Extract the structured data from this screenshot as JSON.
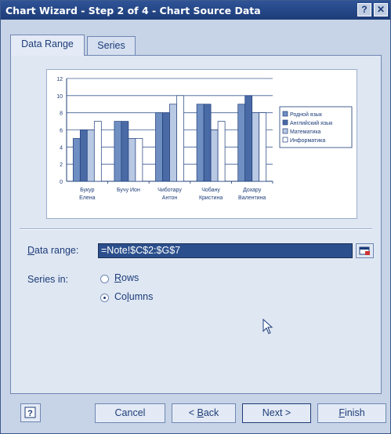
{
  "window": {
    "title": "Chart Wizard - Step 2 of 4 - Chart Source Data",
    "help_glyph": "?",
    "close_glyph": "✕"
  },
  "tabs": [
    {
      "label": "Data Range",
      "active": true
    },
    {
      "label": "Series",
      "active": false
    }
  ],
  "chart_data": {
    "type": "bar",
    "categories": [
      [
        "Букур",
        "Елена"
      ],
      [
        "Бучу Ион",
        ""
      ],
      [
        "Чиботару",
        "Антон"
      ],
      [
        "Чобану",
        "Кристина"
      ],
      [
        "Дохару",
        "Валентина"
      ]
    ],
    "series": [
      {
        "name": "Родной язык",
        "values": [
          5,
          7,
          8,
          9,
          9
        ],
        "fill": "#6f8fc2"
      },
      {
        "name": "Английский язык",
        "values": [
          6,
          7,
          8,
          9,
          10
        ],
        "fill": "#4a6aa6"
      },
      {
        "name": "Математика",
        "values": [
          6,
          5,
          9,
          6,
          8
        ],
        "fill": "#b9c9e4"
      },
      {
        "name": "Информатика",
        "values": [
          7,
          5,
          10,
          7,
          8
        ],
        "fill": "#ffffff"
      }
    ],
    "ylim": [
      0,
      12
    ],
    "yticks": [
      "0",
      "2",
      "4",
      "6",
      "8",
      "10",
      "12"
    ],
    "grid": true,
    "legend": "right"
  },
  "form": {
    "data_range_label": "Data range:",
    "data_range_value": "=Note!$C$2:$G$7",
    "series_in_label": "Series in:",
    "rows_label": "Rows",
    "columns_label": "Columns",
    "selected": "columns"
  },
  "buttons": {
    "cancel": "Cancel",
    "back": "< Back",
    "next": "Next >",
    "finish": "Finish"
  },
  "icons": {
    "help": "help-icon",
    "collapse": "collapse-dialog-icon",
    "cursor": "mouse-pointer-icon"
  }
}
